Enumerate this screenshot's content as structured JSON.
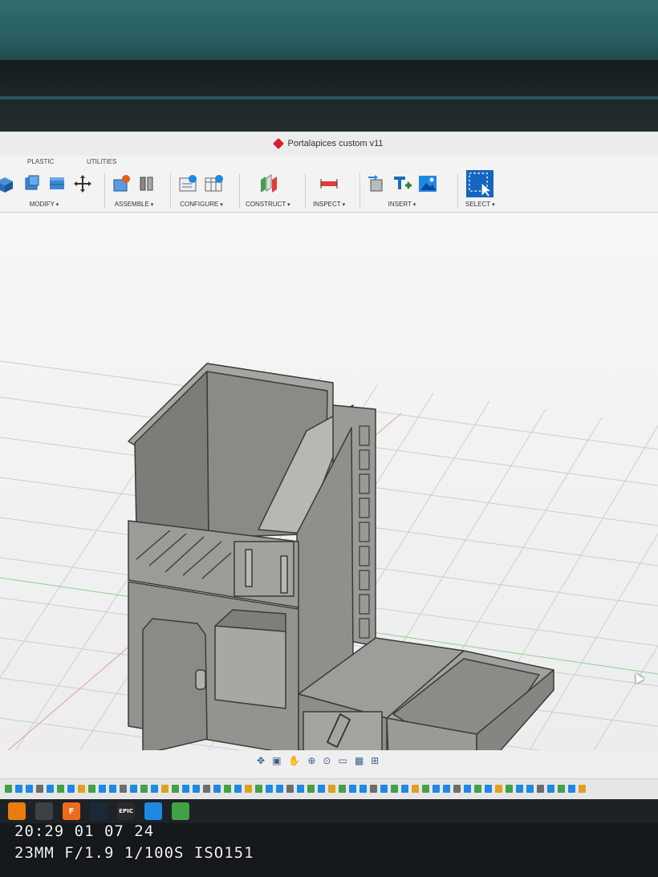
{
  "window": {
    "title": "Portalapices custom v11"
  },
  "ribbon": {
    "tabs": [
      "PLASTIC",
      "UTILITIES"
    ],
    "groups": [
      {
        "label": "MODIFY",
        "icons": [
          "press-pull-icon",
          "shell-icon",
          "combine-icon",
          "move-icon"
        ]
      },
      {
        "label": "ASSEMBLE",
        "icons": [
          "new-component-icon",
          "joint-icon"
        ]
      },
      {
        "label": "CONFIGURE",
        "icons": [
          "parameters-icon",
          "configuration-table-icon"
        ]
      },
      {
        "label": "CONSTRUCT",
        "icons": [
          "offset-plane-icon"
        ]
      },
      {
        "label": "INSPECT",
        "icons": [
          "measure-icon"
        ]
      },
      {
        "label": "INSERT",
        "icons": [
          "insert-derive-icon",
          "insert-text-icon",
          "insert-image-icon"
        ]
      },
      {
        "label": "SELECT",
        "icons": [
          "window-select-icon"
        ]
      }
    ]
  },
  "navigation_bar": {
    "icons": [
      "orbit-icon",
      "look-at-icon",
      "pan-icon",
      "zoom-icon",
      "fit-icon",
      "display-settings-icon",
      "grid-settings-icon",
      "viewports-icon"
    ]
  },
  "taskbar": {
    "apps": [
      {
        "name": "blender-icon",
        "color": "#e87d0d",
        "glyph": ""
      },
      {
        "name": "zbrush-icon",
        "color": "#3c4146",
        "glyph": ""
      },
      {
        "name": "fusion-icon",
        "color": "#f06a1d",
        "glyph": "F"
      },
      {
        "name": "steam-icon",
        "color": "#1b2838",
        "glyph": ""
      },
      {
        "name": "epic-games-icon",
        "color": "#2a2a2a",
        "glyph": "EPIC"
      },
      {
        "name": "app-blue-icon",
        "color": "#1e88e5",
        "glyph": ""
      },
      {
        "name": "app-green-icon",
        "color": "#43a047",
        "glyph": ""
      }
    ]
  },
  "photo_overlay": {
    "timestamp": "20:29 01 07 24",
    "camera_info": "23MM F/1.9 1/100S ISO151"
  },
  "colors": {
    "model": "#8f8f8a",
    "model_dark": "#6e6e6a",
    "model_light": "#a9a9a4",
    "grid": "#c9ced3",
    "x_axis": "#e07a7a",
    "y_axis": "#7fc77f",
    "accent": "#1565c0"
  }
}
